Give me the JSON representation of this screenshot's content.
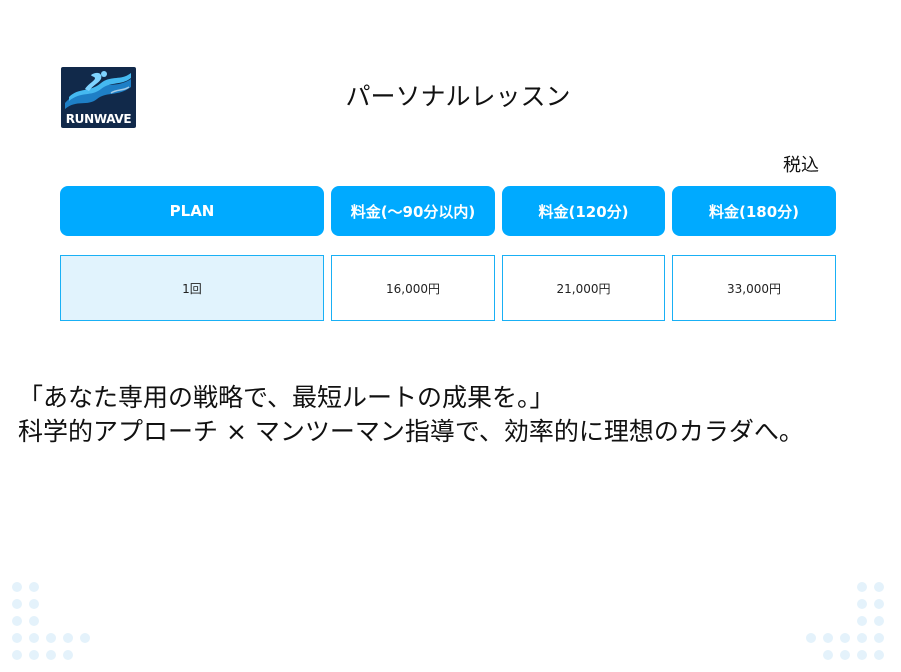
{
  "logo": {
    "text": "RUNWAVE",
    "colors": {
      "background": "#11294a",
      "wave": "#1e7fc6",
      "wave_light": "#45b9f0"
    }
  },
  "title": "パーソナルレッスン",
  "tax_note": "税込",
  "table": {
    "headers": [
      "PLAN",
      "料金(〜90分以内)",
      "料金(120分)",
      "料金(180分)"
    ],
    "rows": [
      [
        "1回",
        "16,000円",
        "21,000円",
        "33,000円"
      ]
    ]
  },
  "tagline": {
    "line1": "「あなた専用の戦略で、最短ルートの成果を。」",
    "line2": "科学的アプローチ × マンツーマン指導で、効率的に理想のカラダへ。"
  },
  "colors": {
    "accent": "#00aaff",
    "cell_border": "#19b0f5",
    "highlight_cell": "#e1f3fd",
    "decor_dots": "#e4f2fb"
  }
}
